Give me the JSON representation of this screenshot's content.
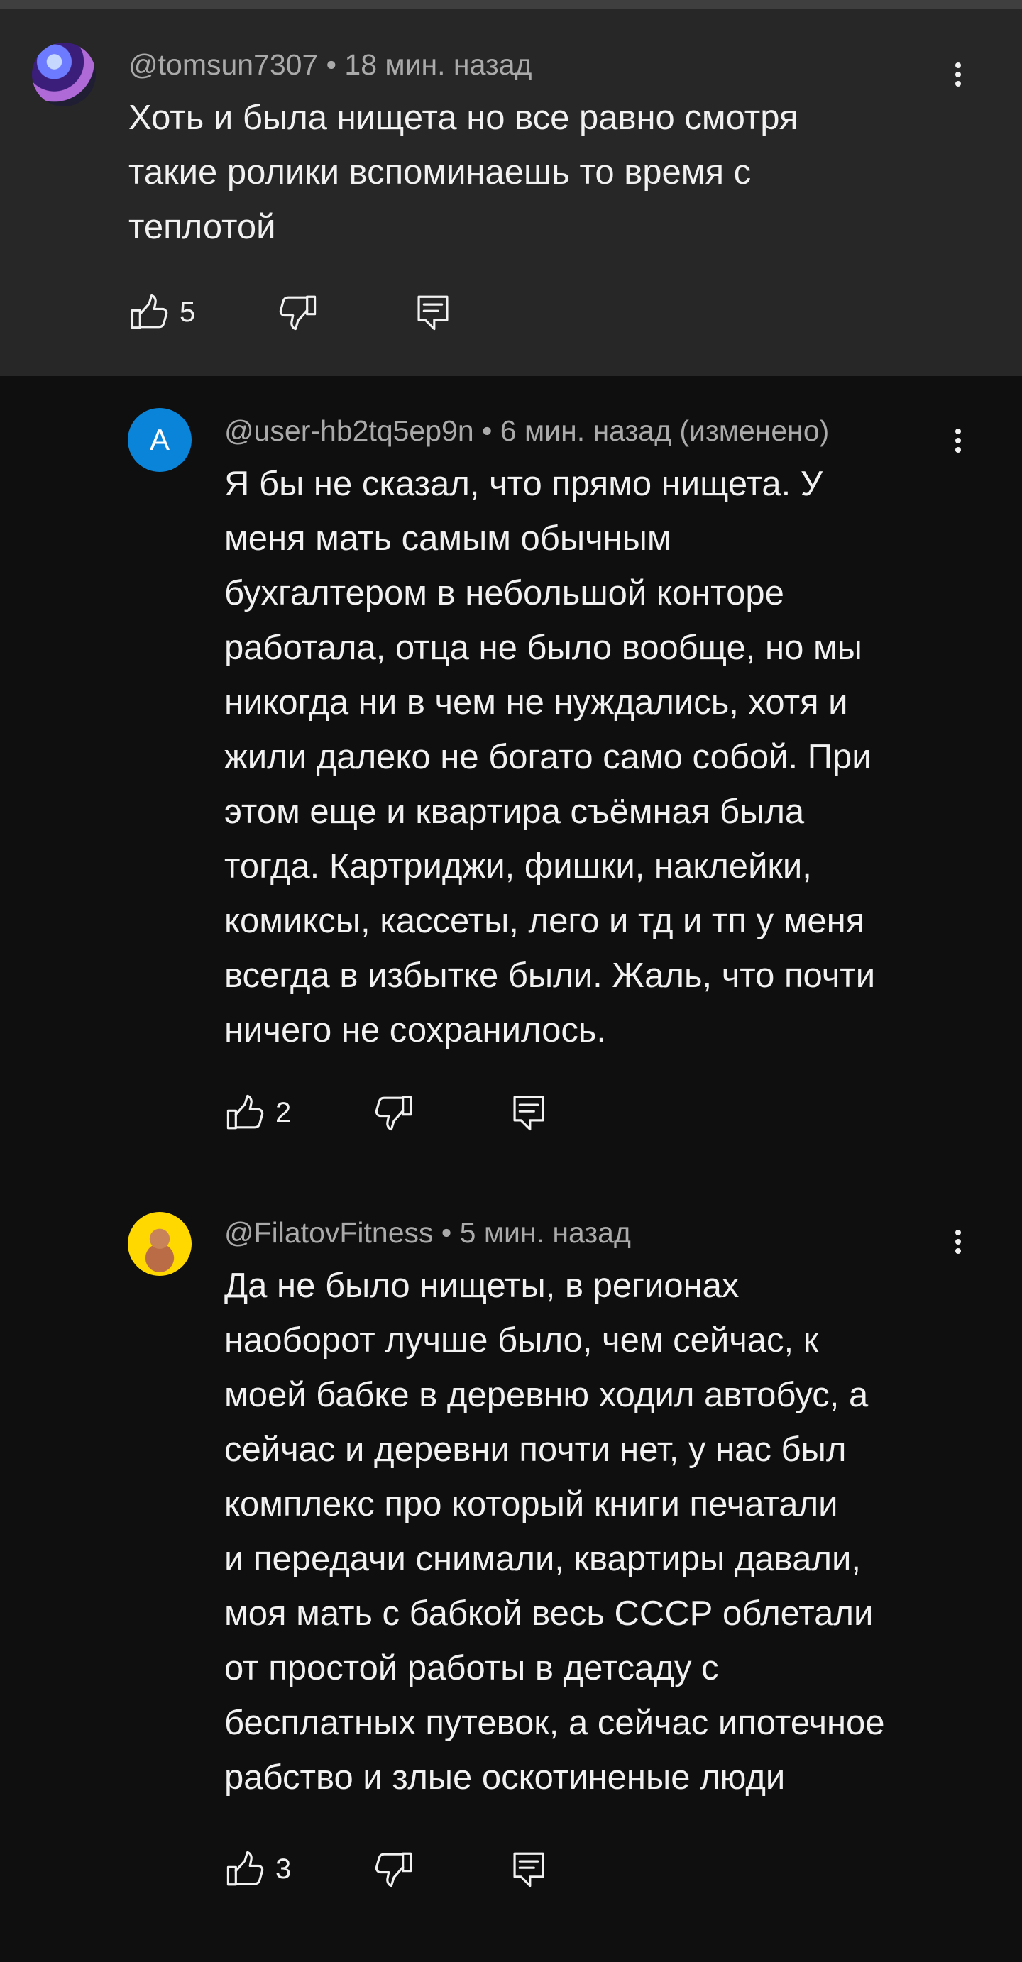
{
  "comments": [
    {
      "author": "@tomsun7307",
      "meta_suffix": " • 18 мин. назад",
      "text": "Хоть и была нищета но все равно смотря\nтакие ролики вспоминаешь то время с\nтеплотой",
      "likes": "5",
      "avatar_icon": "user-avatar-photo"
    },
    {
      "author": "@user-hb2tq5ep9n",
      "meta_suffix": " • 6 мин. назад (изменено)",
      "avatar_letter": "A",
      "text": "Я бы не сказал, что прямо нищета. У\nменя мать самым обычным\nбухгалтером в небольшой конторе\nработала, отца не было вообще, но мы\nникогда ни в чем не нуждались, хотя и\nжили далеко не богато само собой. При\nэтом еще и квартира съёмная была\nтогда. Картриджи, фишки, наклейки,\nкомиксы, кассеты, лего и тд и тп у меня\nвсегда в избытке были. Жаль, что почти\nничего не сохранилось.",
      "likes": "2"
    },
    {
      "author": "@FilatovFitness",
      "meta_suffix": " • 5 мин. назад",
      "text": "Да не было нищеты, в регионах\nнаоборот лучше было, чем сейчас, к\nмоей бабке в деревню ходил автобус, а\nсейчас и деревни почти нет, у нас был\nкомплекс про который книги печатали\nи передачи снимали, квартиры давали,\nмоя мать с бабкой весь СССР облетали\nот простой работы в детсаду с\nбесплатных путевок, а сейчас ипотечное\nрабство и злые оскотиненые люди",
      "likes": "3",
      "avatar_icon": "user-avatar-photo"
    }
  ],
  "icons": {
    "like": "thumb-up-icon",
    "dislike": "thumb-down-icon",
    "reply": "reply-icon",
    "more": "more-vertical-icon"
  },
  "colors": {
    "background": "#0f0f0f",
    "highlight_background": "#272727",
    "text_primary": "#f1f1f1",
    "text_secondary": "#aaaaaa",
    "avatar_letter_bg": "#0a84d8"
  }
}
